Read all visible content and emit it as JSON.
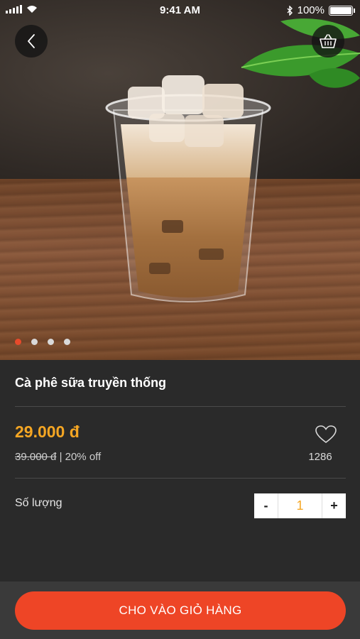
{
  "status": {
    "time": "9:41 AM",
    "battery": "100%"
  },
  "hero": {
    "carousel_dots": 4,
    "active_dot": 0
  },
  "product": {
    "name": "Cà phê sữa truyền thống",
    "price": "29.000 đ",
    "old_price": "39.000 đ",
    "discount": "| 20% off",
    "likes": "1286"
  },
  "quantity": {
    "label": "Số lượng",
    "minus": "-",
    "value": "1",
    "plus": "+"
  },
  "cta": {
    "label": "CHO VÀO GIỎ HÀNG"
  },
  "colors": {
    "accent": "#ee4526",
    "price": "#f5a623",
    "background": "#2a2a2a"
  },
  "icons": [
    "back-icon",
    "basket-icon",
    "heart-icon",
    "signal-icon",
    "wifi-icon",
    "bluetooth-icon",
    "battery-icon"
  ]
}
